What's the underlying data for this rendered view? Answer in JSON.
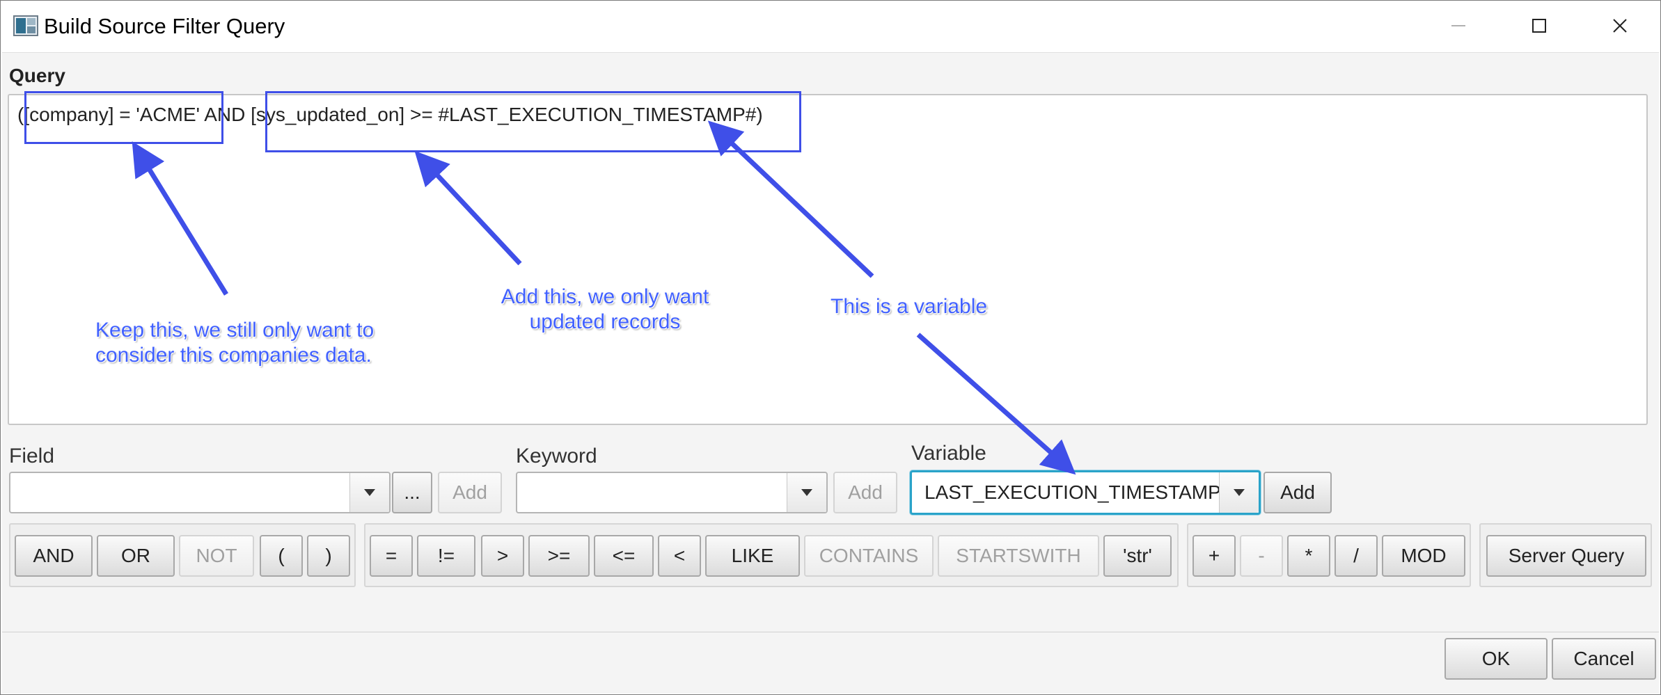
{
  "window": {
    "title": "Build Source Filter Query"
  },
  "query": {
    "label": "Query",
    "text": "([company] = 'ACME' AND [sys_updated_on] >= #LAST_EXECUTION_TIMESTAMP#)"
  },
  "field": {
    "label": "Field",
    "value": "",
    "browse_label": "...",
    "add_label": "Add"
  },
  "keyword": {
    "label": "Keyword",
    "value": "",
    "add_label": "Add"
  },
  "variable": {
    "label": "Variable",
    "value": "LAST_EXECUTION_TIMESTAMP",
    "add_label": "Add"
  },
  "logic_buttons": [
    {
      "label": "AND",
      "enabled": true
    },
    {
      "label": "OR",
      "enabled": true
    },
    {
      "label": "NOT",
      "enabled": false
    },
    {
      "label": "(",
      "enabled": true
    },
    {
      "label": ")",
      "enabled": true
    }
  ],
  "compare_buttons": [
    {
      "label": "=",
      "enabled": true
    },
    {
      "label": "!=",
      "enabled": true
    },
    {
      "label": ">",
      "enabled": true
    },
    {
      "label": ">=",
      "enabled": true
    },
    {
      "label": "<=",
      "enabled": true
    },
    {
      "label": "<",
      "enabled": true
    },
    {
      "label": "LIKE",
      "enabled": true
    },
    {
      "label": "CONTAINS",
      "enabled": false
    },
    {
      "label": "STARTSWITH",
      "enabled": false
    },
    {
      "label": "'str'",
      "enabled": true
    }
  ],
  "math_buttons": [
    {
      "label": "+",
      "enabled": true
    },
    {
      "label": "-",
      "enabled": false
    },
    {
      "label": "*",
      "enabled": true
    },
    {
      "label": "/",
      "enabled": true
    },
    {
      "label": "MOD",
      "enabled": true
    }
  ],
  "server_query_label": "Server Query",
  "footer": {
    "ok_label": "OK",
    "cancel_label": "Cancel"
  },
  "annotations": {
    "keep_line1": "Keep this, we still only want to",
    "keep_line2": "consider this companies data.",
    "add_line1": "Add this, we only want",
    "add_line2": "updated records",
    "variable_note": "This is a variable"
  },
  "colors": {
    "annotation": "#3f4fe8",
    "focus": "#2aa3c9"
  }
}
